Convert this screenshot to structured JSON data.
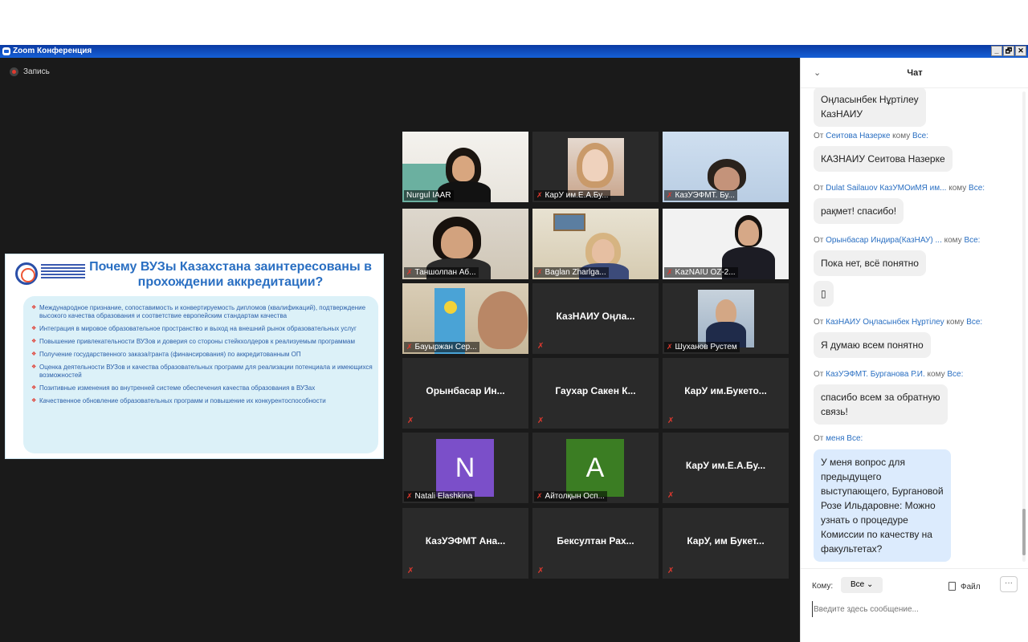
{
  "window": {
    "title": "Zoom Конференция",
    "buttons": [
      "_",
      "🗗",
      "✕"
    ]
  },
  "recording": {
    "label": "Запись"
  },
  "slide": {
    "title": "Почему ВУЗы Казахстана заинтересованы в прохождении аккредитации?",
    "bullets": [
      "Международное признание, сопоставимость и конвертируемость дипломов (квалификаций), подтверждение высокого качества образования и соответствие европейским стандартам качества",
      "Интеграция в мировое образовательное пространство и выход на внешний рынок образовательных услуг",
      "Повышение привлекательности ВУЗов и доверия со стороны стейкхолдеров к реализуемым программам",
      "Получение государственного заказа/гранта (финансирования) по аккредитованным ОП",
      "Оценка деятельности ВУЗов и качества образовательных программ для реализации потенциала и имеющихся возможностей",
      "Позитивные изменения во внутренней системе обеспечения качества образования в ВУЗах",
      "Качественное обновление образовательных программ и повышение их конкурентоспособности"
    ]
  },
  "participants": [
    {
      "name": "Nurgul IAAR",
      "video": true,
      "muted": false,
      "active": true
    },
    {
      "name": "КарУ им.Е.А.Бу...",
      "video": true,
      "muted": true
    },
    {
      "name": "КазУЭФМТ. Бу...",
      "video": true,
      "muted": true
    },
    {
      "name": "Таншолпан Аб...",
      "video": true,
      "muted": true
    },
    {
      "name": "Baglan Zharlga...",
      "video": true,
      "muted": true
    },
    {
      "name": "KazNAIU OZ-2...",
      "video": true,
      "muted": true
    },
    {
      "name": "Бауыржан Сер...",
      "video": true,
      "muted": true
    },
    {
      "name": "КазНАИУ Оңла...",
      "video": false,
      "muted": true
    },
    {
      "name": "Шуханов Рустем",
      "video": true,
      "muted": true
    },
    {
      "name": "Орынбасар Ин...",
      "video": false,
      "muted": true
    },
    {
      "name": "Гаухар Сакен К...",
      "video": false,
      "muted": true
    },
    {
      "name": "КарУ им.Букето...",
      "video": false,
      "muted": true
    },
    {
      "name": "Natali Elashkina",
      "avatar": "N",
      "avatar_color": "#7b4fc9",
      "muted": true
    },
    {
      "name": "Айтолқын Осп...",
      "avatar": "A",
      "avatar_color": "#3b7d23",
      "muted": true
    },
    {
      "name": "КарУ им.Е.А.Бу...",
      "video": false,
      "muted": true
    },
    {
      "name": "КазУЭФМТ Ана...",
      "video": false,
      "muted": true
    },
    {
      "name": "Бексултан Рах...",
      "video": false,
      "muted": true
    },
    {
      "name": "КарУ, им Букет...",
      "video": false,
      "muted": true
    }
  ],
  "chat": {
    "title": "Чат",
    "messages": [
      {
        "meta_from": "",
        "meta_to": "",
        "text": "Оңласынбек Нұртілеу\nКазНАИУ"
      },
      {
        "meta_pre": "От ",
        "meta_from": "Сеитова Назерке",
        "meta_mid": " кому ",
        "meta_to": "Все:",
        "text": "КАЗНАИУ Сеитова Назерке"
      },
      {
        "meta_pre": "От ",
        "meta_from": "Dulat Sailauov КазУМОиМЯ им...",
        "meta_mid": " кому ",
        "meta_to": "Все:",
        "text": "рақмет! спасибо!"
      },
      {
        "meta_pre": "От ",
        "meta_from": "Орынбасар Индира(КазНАУ) ...",
        "meta_mid": "  кому ",
        "meta_to": "Все:",
        "text": "Пока нет, всё понятно"
      },
      {
        "meta_from": "",
        "meta_to": "",
        "text": "▯"
      },
      {
        "meta_pre": "От ",
        "meta_from": "КазНАИУ Оңласынбек Нұртілеу",
        "meta_mid": " кому ",
        "meta_to": "Все:",
        "text": "Я думаю всем понятно"
      },
      {
        "meta_pre": "От ",
        "meta_from": "КазУЭФМТ. Бурганова Р.И.",
        "meta_mid": " кому ",
        "meta_to": "Все:",
        "text": "спасибо всем за обратную\nсвязь!"
      },
      {
        "meta_pre": "От ",
        "meta_from": "меня",
        "meta_mid": " ",
        "meta_to": "Все:",
        "text": "У меня вопрос для\nпредыдущего\nвыступающего, Бургановой\nРозе Ильдаровне: Можно\nузнать о процедуре\nКомиссии по качеству на\nфакультетах?",
        "mine": true
      }
    ],
    "to_label": "Кому:",
    "to_value": "Все",
    "file_label": "Файл",
    "more_label": "···",
    "input_placeholder": "Введите здесь сообщение..."
  }
}
